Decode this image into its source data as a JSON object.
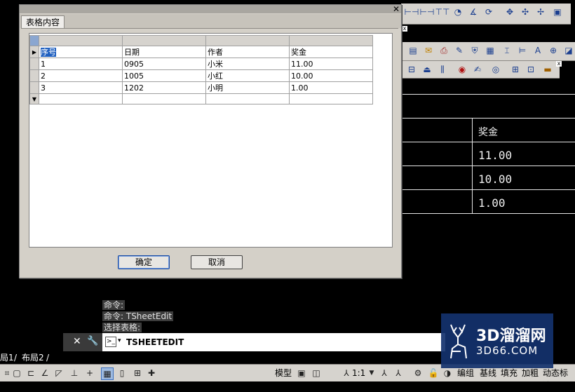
{
  "dialog": {
    "tab_label": "表格内容",
    "close_glyph": "✕",
    "ok_label": "确定",
    "cancel_label": "取消"
  },
  "grid": {
    "rows": [
      [
        "序号",
        "日期",
        "作者",
        "奖金"
      ],
      [
        "1",
        "0905",
        "小米",
        "11.00"
      ],
      [
        "2",
        "1005",
        "小红",
        "10.00"
      ],
      [
        "3",
        "1202",
        "小明",
        "1.00"
      ]
    ]
  },
  "drawing": {
    "header": "奖金",
    "values": [
      "11.00",
      "10.00",
      "1.00"
    ]
  },
  "command": {
    "line1": "命令:",
    "line2": "命令: TSheetEdit",
    "line3": "选择表格:",
    "input_value": "TSHEETEDIT"
  },
  "layout_tabs": {
    "tab1": "局1",
    "tab2": "布局2"
  },
  "status": {
    "model": "模型",
    "scale": "1:1",
    "labels": [
      "编组",
      "基线",
      "填充",
      "加粗",
      "动态标注"
    ]
  },
  "watermark": {
    "title": "3D溜溜网",
    "url": "3D66.COM"
  },
  "colors": {
    "selection": "#1f5fbf",
    "toolbar": "#d6d3ce",
    "watermark_bg": "#14326e"
  }
}
